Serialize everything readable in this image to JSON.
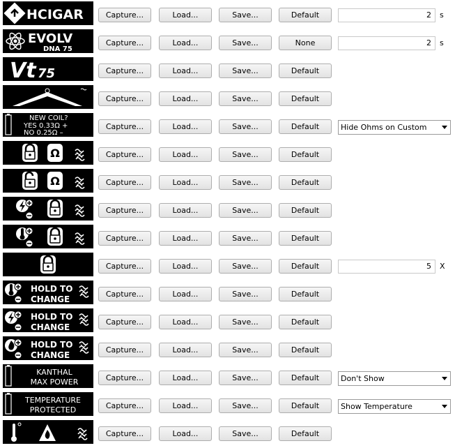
{
  "buttons": {
    "capture": "Capture...",
    "load": "Load...",
    "save": "Save...",
    "default": "Default",
    "none": "None"
  },
  "previews": {
    "hcigar": "HCIGAR",
    "evolv": "EVOLV",
    "dna": "DNA 75",
    "vt": "Vt",
    "vt_num": "75",
    "new_coil": [
      "NEW COIL?",
      "YES 0.33Ω +",
      "NO  0.25Ω –"
    ],
    "hold_to": "HOLD TO",
    "change": "CHANGE",
    "kanthal": [
      "KANTHAL",
      "MAX POWER"
    ],
    "temp_protected": [
      "TEMPERATURE",
      "PROTECTED"
    ]
  },
  "rows": [
    {
      "type": "hcigar",
      "default_label": "Default",
      "numeric": "2",
      "unit": "s"
    },
    {
      "type": "evolv",
      "default_label": "None",
      "numeric": "2",
      "unit": "s"
    },
    {
      "type": "vt",
      "default_label": "Default"
    },
    {
      "type": "arrow",
      "default_label": "Default"
    },
    {
      "type": "newcoil",
      "default_label": "Default",
      "select": "Hide Ohms on Custom"
    },
    {
      "type": "lock-ohm",
      "default_label": "Default"
    },
    {
      "type": "unlock-ohm",
      "default_label": "Default"
    },
    {
      "type": "power-lock",
      "default_label": "Default"
    },
    {
      "type": "temp-lock",
      "default_label": "Default"
    },
    {
      "type": "lock-only",
      "default_label": "Default",
      "numeric": "5",
      "unit": "X"
    },
    {
      "type": "hold-temp",
      "default_label": "Default"
    },
    {
      "type": "hold-power",
      "default_label": "Default"
    },
    {
      "type": "hold-flame",
      "default_label": "Default"
    },
    {
      "type": "kanthal",
      "default_label": "Default",
      "select": "Don't Show"
    },
    {
      "type": "temperature",
      "default_label": "Default",
      "select": "Show Temperature"
    },
    {
      "type": "battery-flame",
      "default_label": "Default"
    }
  ]
}
